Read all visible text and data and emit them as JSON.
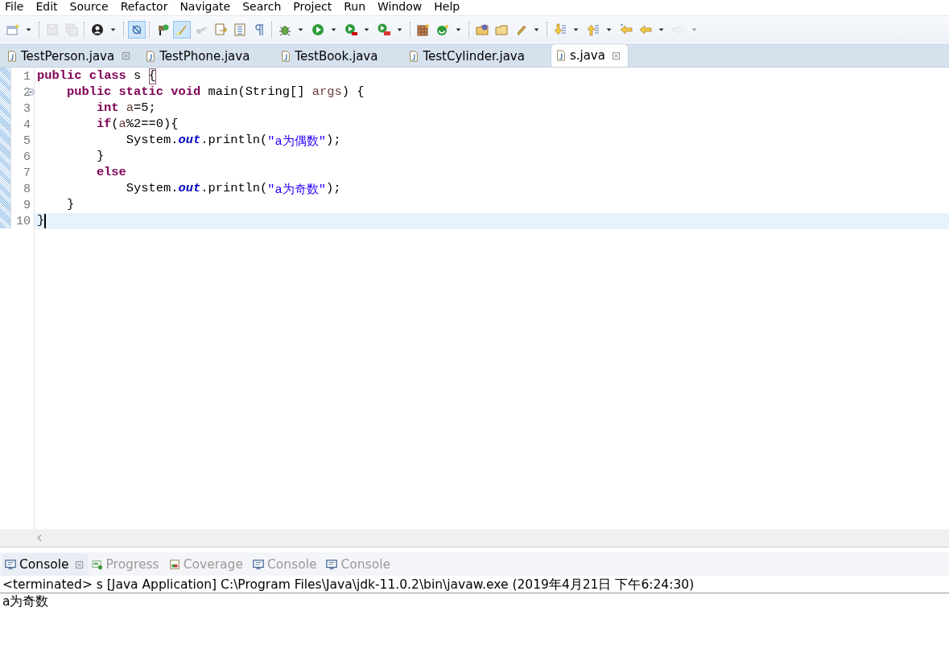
{
  "menu": [
    "File",
    "Edit",
    "Source",
    "Refactor",
    "Navigate",
    "Search",
    "Project",
    "Run",
    "Window",
    "Help"
  ],
  "toolbar": [
    {
      "kind": "button",
      "pressed": false,
      "disabled": false,
      "dropdown": true
    },
    {
      "kind": "separator"
    },
    {
      "kind": "button",
      "pressed": false,
      "disabled": true,
      "dropdown": false
    },
    {
      "kind": "button",
      "pressed": false,
      "disabled": true,
      "dropdown": false
    },
    {
      "kind": "separator"
    },
    {
      "kind": "button",
      "pressed": false,
      "disabled": false,
      "dropdown": true
    },
    {
      "kind": "separator"
    },
    {
      "kind": "button",
      "pressed": true,
      "disabled": false,
      "dropdown": false
    },
    {
      "kind": "separator"
    },
    {
      "kind": "button",
      "pressed": false,
      "disabled": false,
      "dropdown": false
    },
    {
      "kind": "button",
      "pressed": true,
      "disabled": false,
      "dropdown": false
    },
    {
      "kind": "button",
      "pressed": false,
      "disabled": true,
      "dropdown": false
    },
    {
      "kind": "button",
      "pressed": false,
      "disabled": false,
      "dropdown": false
    },
    {
      "kind": "button",
      "pressed": false,
      "disabled": false,
      "dropdown": false
    },
    {
      "kind": "button",
      "pressed": false,
      "disabled": false,
      "dropdown": false
    },
    {
      "kind": "separator"
    },
    {
      "kind": "button",
      "pressed": false,
      "disabled": false,
      "dropdown": true
    },
    {
      "kind": "button",
      "pressed": false,
      "disabled": false,
      "dropdown": true
    },
    {
      "kind": "button",
      "pressed": false,
      "disabled": false,
      "dropdown": true
    },
    {
      "kind": "button",
      "pressed": false,
      "disabled": false,
      "dropdown": true
    },
    {
      "kind": "separator"
    },
    {
      "kind": "button",
      "pressed": false,
      "disabled": false,
      "dropdown": false
    },
    {
      "kind": "button",
      "pressed": false,
      "disabled": false,
      "dropdown": true
    },
    {
      "kind": "separator"
    },
    {
      "kind": "button",
      "pressed": false,
      "disabled": false,
      "dropdown": false
    },
    {
      "kind": "button",
      "pressed": false,
      "disabled": false,
      "dropdown": false
    },
    {
      "kind": "button",
      "pressed": false,
      "disabled": false,
      "dropdown": true
    },
    {
      "kind": "separator"
    },
    {
      "kind": "button",
      "pressed": false,
      "disabled": false,
      "dropdown": true
    },
    {
      "kind": "button",
      "pressed": false,
      "disabled": false,
      "dropdown": true
    },
    {
      "kind": "button",
      "pressed": false,
      "disabled": false,
      "dropdown": false
    },
    {
      "kind": "button",
      "pressed": false,
      "disabled": false,
      "dropdown": true
    },
    {
      "kind": "button",
      "pressed": false,
      "disabled": true,
      "dropdown": true
    }
  ],
  "editor_tabs": [
    {
      "label": "TestPerson.java",
      "selected": false,
      "closable": true
    },
    {
      "label": "TestPhone.java",
      "selected": false,
      "closable": false
    },
    {
      "label": "TestBook.java",
      "selected": false,
      "closable": false
    },
    {
      "label": "TestCylinder.java",
      "selected": false,
      "closable": false
    },
    {
      "label": "s.java",
      "selected": true,
      "closable": true
    }
  ],
  "editor": {
    "lines": [
      {
        "number": "1",
        "foldable": false,
        "current": false,
        "tokens": [
          {
            "kind": "keyword",
            "text": "public "
          },
          {
            "kind": "keyword",
            "text": "class "
          },
          {
            "kind": "plain",
            "text": "s "
          },
          {
            "kind": "matched-bracket",
            "text": "{"
          }
        ]
      },
      {
        "number": "2",
        "foldable": true,
        "current": false,
        "tokens": [
          {
            "kind": "keyword",
            "text": "    public "
          },
          {
            "kind": "keyword",
            "text": "static "
          },
          {
            "kind": "keyword",
            "text": "void "
          },
          {
            "kind": "plain",
            "text": "main(String[] "
          },
          {
            "kind": "param",
            "text": "args"
          },
          {
            "kind": "plain",
            "text": ") {"
          }
        ]
      },
      {
        "number": "3",
        "foldable": false,
        "current": false,
        "tokens": [
          {
            "kind": "keyword",
            "text": "        int "
          },
          {
            "kind": "local",
            "text": "a"
          },
          {
            "kind": "plain",
            "text": "=5;"
          }
        ]
      },
      {
        "number": "4",
        "foldable": false,
        "current": false,
        "tokens": [
          {
            "kind": "keyword",
            "text": "        if"
          },
          {
            "kind": "plain",
            "text": "("
          },
          {
            "kind": "local",
            "text": "a"
          },
          {
            "kind": "plain",
            "text": "%2==0){"
          }
        ]
      },
      {
        "number": "5",
        "foldable": false,
        "current": false,
        "tokens": [
          {
            "kind": "plain",
            "text": "            System."
          },
          {
            "kind": "field",
            "text": "out"
          },
          {
            "kind": "plain",
            "text": ".println("
          },
          {
            "kind": "string",
            "text": "\"a为偶数\""
          },
          {
            "kind": "plain",
            "text": ");"
          }
        ]
      },
      {
        "number": "6",
        "foldable": false,
        "current": false,
        "tokens": [
          {
            "kind": "plain",
            "text": "        }"
          }
        ]
      },
      {
        "number": "7",
        "foldable": false,
        "current": false,
        "tokens": [
          {
            "kind": "keyword",
            "text": "        else"
          }
        ]
      },
      {
        "number": "8",
        "foldable": false,
        "current": false,
        "tokens": [
          {
            "kind": "plain",
            "text": "            System."
          },
          {
            "kind": "field",
            "text": "out"
          },
          {
            "kind": "plain",
            "text": ".println("
          },
          {
            "kind": "string",
            "text": "\"a为奇数\""
          },
          {
            "kind": "plain",
            "text": ");"
          }
        ]
      },
      {
        "number": "9",
        "foldable": false,
        "current": false,
        "tokens": [
          {
            "kind": "plain",
            "text": "    }"
          }
        ]
      },
      {
        "number": "10",
        "foldable": false,
        "current": true,
        "tokens": [
          {
            "kind": "plain",
            "text": "}"
          }
        ]
      }
    ]
  },
  "console_tabs": [
    {
      "label": "Console",
      "selected": true,
      "closable": true
    },
    {
      "label": "Progress",
      "selected": false,
      "closable": false
    },
    {
      "label": "Coverage",
      "selected": false,
      "closable": false
    },
    {
      "label": "Console",
      "selected": false,
      "closable": false
    },
    {
      "label": "Console",
      "selected": false,
      "closable": false
    }
  ],
  "console": {
    "header": "<terminated> s [Java Application] C:\\Program Files\\Java\\jdk-11.0.2\\bin\\javaw.exe (2019年4月21日 下午6:24:30)",
    "output": [
      "a为奇数"
    ]
  }
}
